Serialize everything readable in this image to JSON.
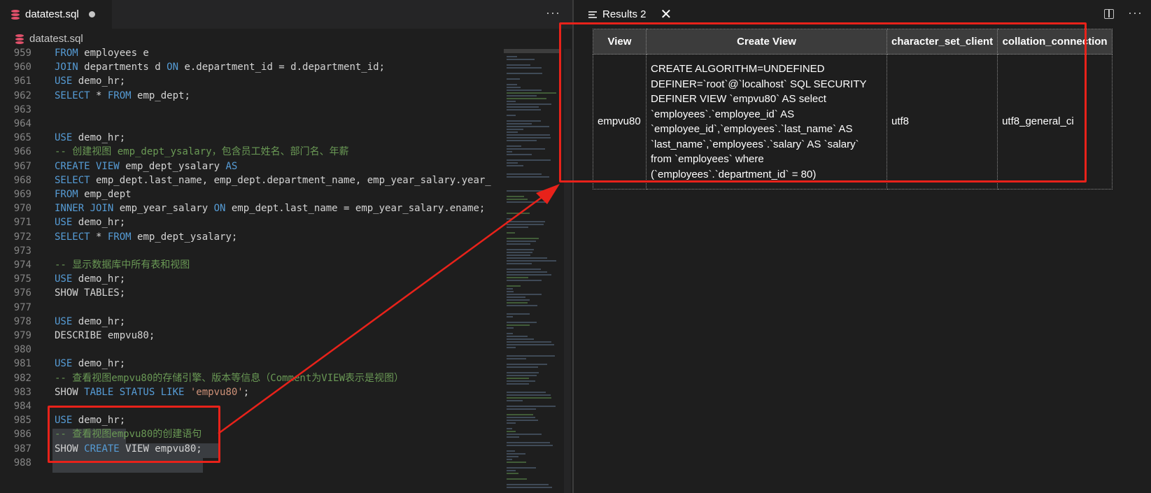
{
  "editor": {
    "tab_title": "datatest.sql",
    "breadcrumb": "datatest.sql",
    "more_label": "···",
    "lines": [
      {
        "num": "959",
        "tokens": [
          {
            "t": "FROM",
            "c": "kw"
          },
          {
            "t": " employees e",
            "c": ""
          }
        ]
      },
      {
        "num": "960",
        "tokens": [
          {
            "t": "JOIN",
            "c": "kw"
          },
          {
            "t": " departments d ",
            "c": ""
          },
          {
            "t": "ON",
            "c": "kw"
          },
          {
            "t": " e.department_id = d.department_id;",
            "c": ""
          }
        ]
      },
      {
        "num": "961",
        "tokens": [
          {
            "t": "USE",
            "c": "kw"
          },
          {
            "t": " demo_hr;",
            "c": ""
          }
        ]
      },
      {
        "num": "962",
        "tokens": [
          {
            "t": "SELECT",
            "c": "kw"
          },
          {
            "t": " * ",
            "c": ""
          },
          {
            "t": "FROM",
            "c": "kw"
          },
          {
            "t": " emp_dept;",
            "c": ""
          }
        ]
      },
      {
        "num": "963",
        "tokens": []
      },
      {
        "num": "964",
        "tokens": []
      },
      {
        "num": "965",
        "tokens": [
          {
            "t": "USE",
            "c": "kw"
          },
          {
            "t": " demo_hr;",
            "c": ""
          }
        ]
      },
      {
        "num": "966",
        "tokens": [
          {
            "t": "-- 创建视图 emp_dept_ysalary，包含员工姓名、部门名、年薪",
            "c": "cm"
          }
        ]
      },
      {
        "num": "967",
        "tokens": [
          {
            "t": "CREATE VIEW",
            "c": "kw"
          },
          {
            "t": " emp_dept_ysalary ",
            "c": ""
          },
          {
            "t": "AS",
            "c": "kw"
          }
        ]
      },
      {
        "num": "968",
        "tokens": [
          {
            "t": "SELECT",
            "c": "kw"
          },
          {
            "t": " emp_dept.last_name, emp_dept.department_name, emp_year_salary.year_",
            "c": ""
          }
        ]
      },
      {
        "num": "969",
        "tokens": [
          {
            "t": "FROM",
            "c": "kw"
          },
          {
            "t": " emp_dept",
            "c": ""
          }
        ]
      },
      {
        "num": "970",
        "tokens": [
          {
            "t": "INNER JOIN",
            "c": "kw"
          },
          {
            "t": " emp_year_salary ",
            "c": ""
          },
          {
            "t": "ON",
            "c": "kw"
          },
          {
            "t": " emp_dept.last_name = emp_year_salary.ename;",
            "c": ""
          }
        ]
      },
      {
        "num": "971",
        "tokens": [
          {
            "t": "USE",
            "c": "kw"
          },
          {
            "t": " demo_hr;",
            "c": ""
          }
        ]
      },
      {
        "num": "972",
        "tokens": [
          {
            "t": "SELECT",
            "c": "kw"
          },
          {
            "t": " * ",
            "c": ""
          },
          {
            "t": "FROM",
            "c": "kw"
          },
          {
            "t": " emp_dept_ysalary;",
            "c": ""
          }
        ]
      },
      {
        "num": "973",
        "tokens": []
      },
      {
        "num": "974",
        "tokens": [
          {
            "t": "-- 显示数据库中所有表和视图",
            "c": "cm"
          }
        ]
      },
      {
        "num": "975",
        "tokens": [
          {
            "t": "USE",
            "c": "kw"
          },
          {
            "t": " demo_hr;",
            "c": ""
          }
        ]
      },
      {
        "num": "976",
        "tokens": [
          {
            "t": "SHOW TABLES;",
            "c": ""
          }
        ]
      },
      {
        "num": "977",
        "tokens": []
      },
      {
        "num": "978",
        "tokens": [
          {
            "t": "USE",
            "c": "kw"
          },
          {
            "t": " demo_hr;",
            "c": ""
          }
        ]
      },
      {
        "num": "979",
        "tokens": [
          {
            "t": "DESCRIBE empvu80;",
            "c": ""
          }
        ]
      },
      {
        "num": "980",
        "tokens": []
      },
      {
        "num": "981",
        "tokens": [
          {
            "t": "USE",
            "c": "kw"
          },
          {
            "t": " demo_hr;",
            "c": ""
          }
        ]
      },
      {
        "num": "982",
        "tokens": [
          {
            "t": "-- 查看视图empvu80的存储引擎、版本等信息（Comment为VIEW表示是视图）",
            "c": "cm"
          }
        ]
      },
      {
        "num": "983",
        "tokens": [
          {
            "t": "SHOW",
            "c": ""
          },
          {
            "t": " TABLE STATUS LIKE ",
            "c": "kw"
          },
          {
            "t": "'empvu80'",
            "c": "str"
          },
          {
            "t": ";",
            "c": ""
          }
        ]
      },
      {
        "num": "984",
        "tokens": []
      },
      {
        "num": "985",
        "tokens": [
          {
            "t": "USE",
            "c": "kw"
          },
          {
            "t": " demo_hr;",
            "c": ""
          }
        ]
      },
      {
        "num": "986",
        "tokens": [
          {
            "t": "-- 查看视图empvu80的创建语句",
            "c": "cm"
          }
        ]
      },
      {
        "num": "987",
        "tokens": [
          {
            "t": "SHOW ",
            "c": ""
          },
          {
            "t": "CREATE",
            "c": "kw"
          },
          {
            "t": " VIEW empvu80;",
            "c": ""
          }
        ]
      },
      {
        "num": "988",
        "tokens": []
      }
    ]
  },
  "results": {
    "tab_title": "Results 2",
    "more_label": "···",
    "columns": [
      "View",
      "Create View",
      "character_set_client",
      "collation_connection"
    ],
    "row": {
      "view": "empvu80",
      "create_view": "CREATE ALGORITHM=UNDEFINED DEFINER=`root`@`localhost` SQL SECURITY DEFINER VIEW `empvu80` AS select `employees`.`employee_id` AS `employee_id`,`employees`.`last_name` AS `last_name`,`employees`.`salary` AS `salary` from `employees` where (`employees`.`department_id` = 80)",
      "character_set_client": "utf8",
      "collation_connection": "utf8_general_ci"
    }
  },
  "colors": {
    "keyword": "#569cd6",
    "comment": "#6a9955",
    "string": "#ce9178",
    "annotation_red": "#e8221a"
  }
}
